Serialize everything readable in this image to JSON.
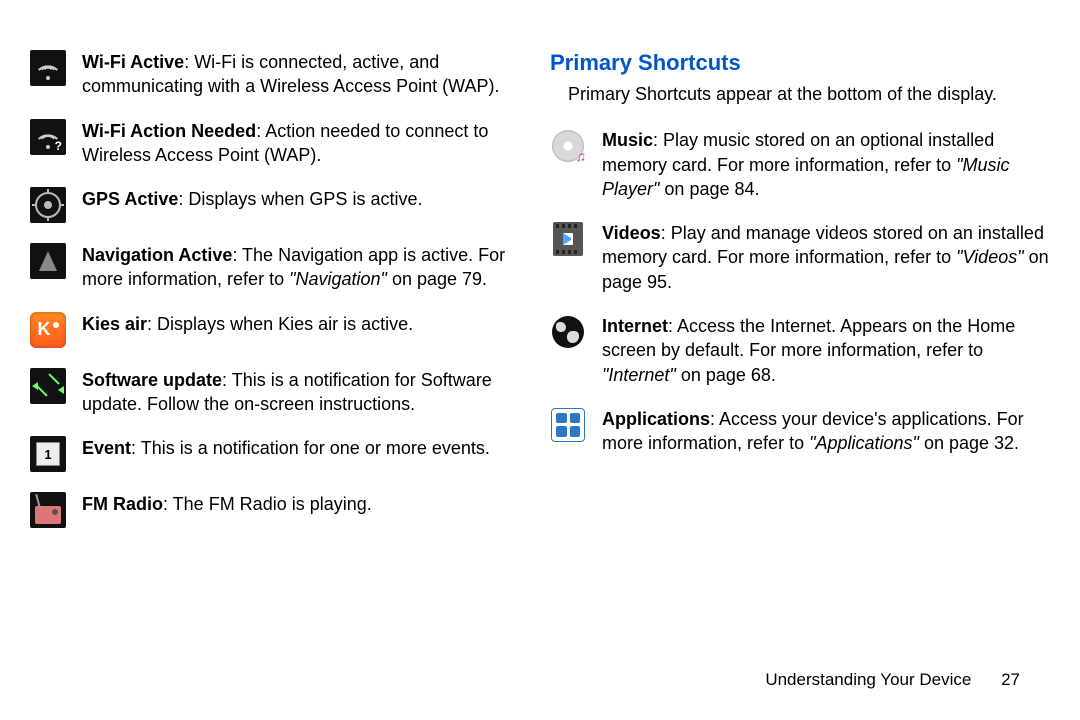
{
  "left": {
    "items": [
      {
        "title": "Wi-Fi Active",
        "desc": ": Wi-Fi is connected, active, and communicating with a Wireless Access Point (WAP)."
      },
      {
        "title": "Wi-Fi Action Needed",
        "desc": ": Action needed to connect to Wireless Access Point (WAP)."
      },
      {
        "title": "GPS Active",
        "desc": ": Displays when GPS is active."
      },
      {
        "title": "Navigation Active",
        "desc_pre": ": The Navigation app is active. For more information, refer to ",
        "ref": "\"Navigation\"",
        "desc_post": " on page 79."
      },
      {
        "title": "Kies air",
        "desc": ": Displays when Kies air is active."
      },
      {
        "title": "Software update",
        "desc": ": This is a notification for Software update. Follow the on-screen instructions."
      },
      {
        "title": "Event",
        "desc": ": This is a notification for one or more events."
      },
      {
        "title": "FM Radio",
        "desc": ": The FM Radio is playing."
      }
    ]
  },
  "right": {
    "heading": "Primary Shortcuts",
    "subtitle": "Primary Shortcuts appear at the bottom of the display.",
    "items": [
      {
        "title": "Music",
        "desc_pre": ": Play music stored on an optional installed memory card. For more information, refer to ",
        "ref": "\"Music Player\"",
        "desc_post": " on page 84."
      },
      {
        "title": "Videos",
        "desc_pre": ": Play and manage videos stored on an installed memory card. For more information, refer to ",
        "ref": "\"Videos\"",
        "desc_post": " on page 95."
      },
      {
        "title": "Internet",
        "desc_pre": ": Access the Internet. Appears on the Home screen by default. For more information, refer to ",
        "ref": "\"Internet\"",
        "desc_post": " on page 68."
      },
      {
        "title": "Applications",
        "desc_pre": ": Access your device's applications. For more information, refer to ",
        "ref": "\"Applications\"",
        "desc_post": " on page 32."
      }
    ]
  },
  "footer": {
    "section": "Understanding Your Device",
    "page": "27"
  }
}
